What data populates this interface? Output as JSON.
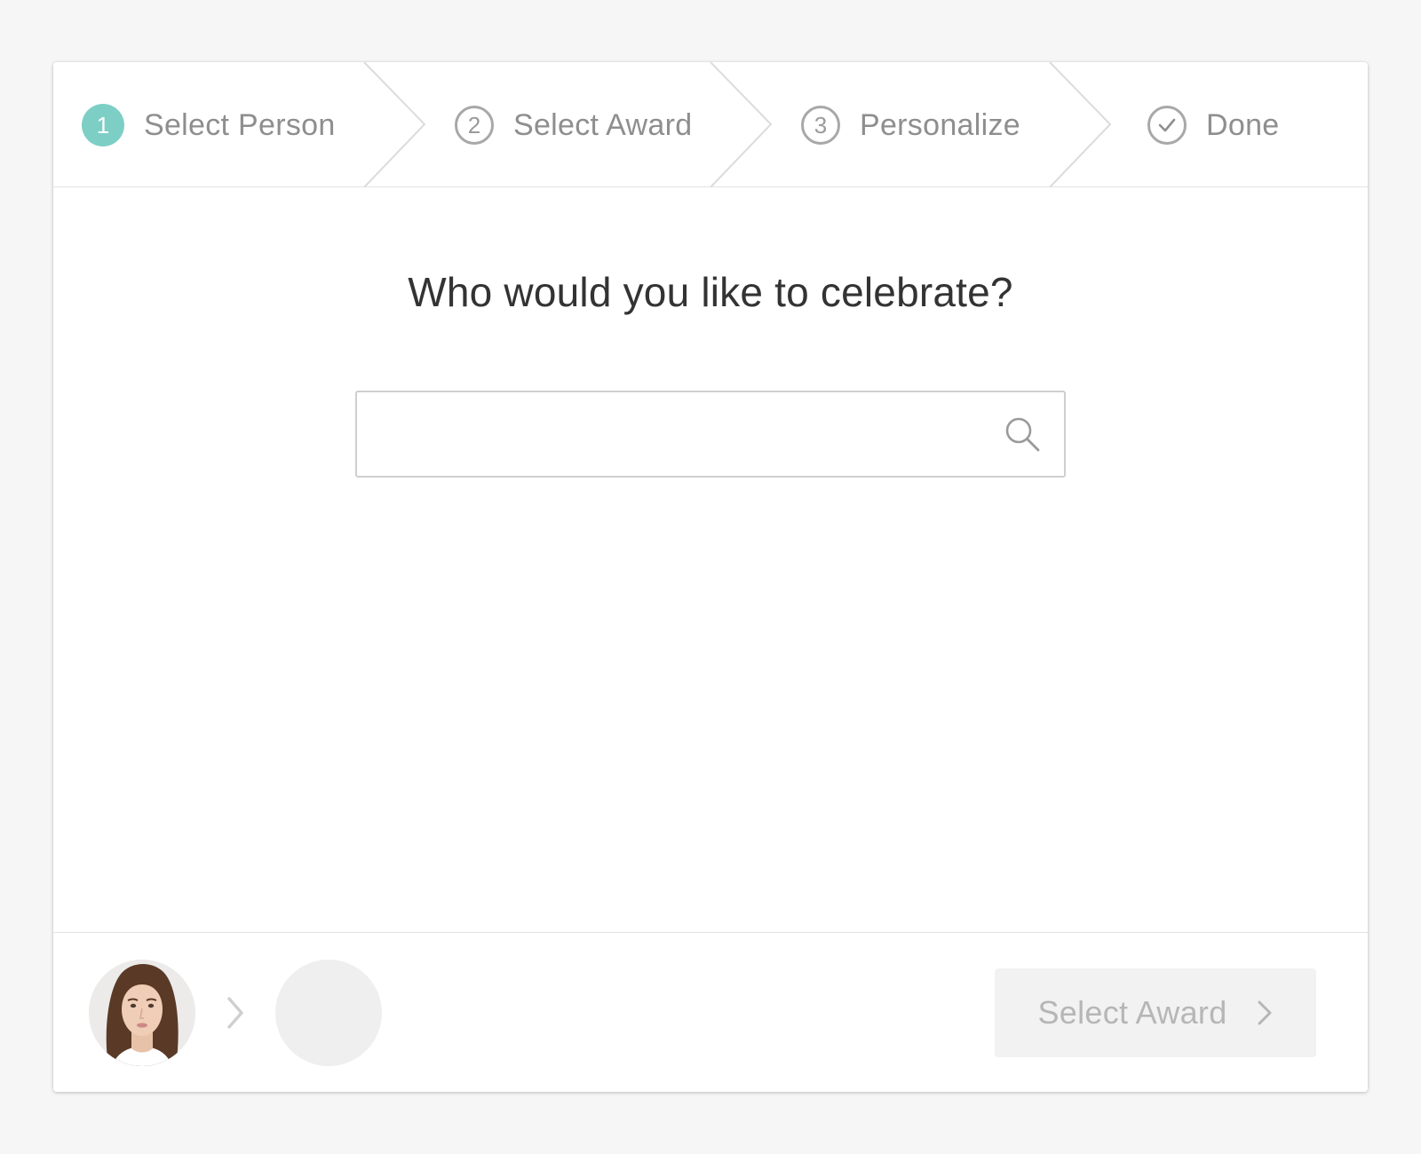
{
  "stepper": {
    "steps": [
      {
        "marker": "1",
        "label": "Select Person",
        "state": "active"
      },
      {
        "marker": "2",
        "label": "Select Award",
        "state": "pending"
      },
      {
        "marker": "3",
        "label": "Personalize",
        "state": "pending"
      },
      {
        "marker": "check-icon",
        "label": "Done",
        "state": "pending"
      }
    ]
  },
  "main": {
    "title": "Who would you like to celebrate?",
    "search": {
      "value": "",
      "placeholder": "",
      "icon": "search-icon"
    }
  },
  "footer": {
    "selected_person_avatar": "avatar-photo",
    "separator_icon": "chevron-right-icon",
    "award_placeholder": "empty-award-circle",
    "next_button": {
      "label": "Select Award",
      "icon": "chevron-right-icon",
      "enabled": false
    }
  },
  "colors": {
    "accent": "#7dcfc6",
    "page_background": "#f6f6f6",
    "card_background": "#ffffff",
    "muted_text": "#8e8e8e",
    "title_text": "#333333",
    "disabled_button_bg": "#f2f2f2",
    "disabled_button_text": "#b6b6b6"
  }
}
